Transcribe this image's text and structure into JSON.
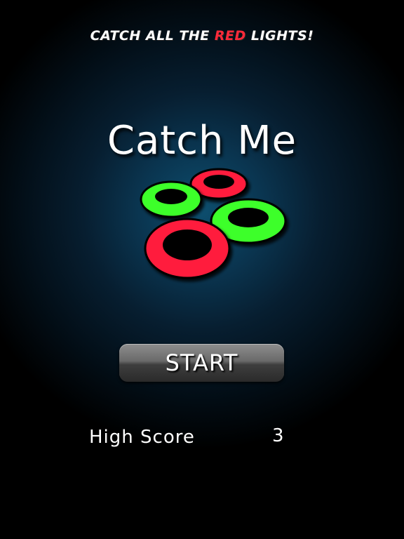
{
  "tagline": {
    "before": "CATCH ALL THE ",
    "highlight": "RED",
    "after": " LIGHTS!"
  },
  "title": "Catch Me",
  "start_button": {
    "label": "START"
  },
  "high_score": {
    "label": "High Score",
    "value": "3"
  },
  "colors": {
    "red_light": "#ff1f3d",
    "green_light": "#3cff2a",
    "background_glow": "#0d4e6e"
  },
  "logo": {
    "lights": [
      {
        "name": "green-light-left",
        "color": "green"
      },
      {
        "name": "red-light-top",
        "color": "red"
      },
      {
        "name": "green-light-right",
        "color": "green"
      },
      {
        "name": "red-light-bottom",
        "color": "red"
      }
    ]
  }
}
